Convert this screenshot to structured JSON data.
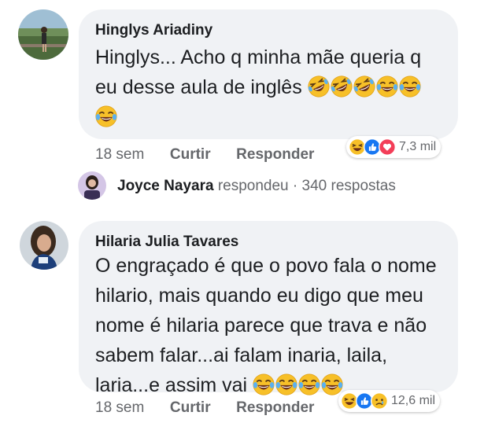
{
  "comments": [
    {
      "author": "Hinglys Ariadiny",
      "text": "Hinglys... Acho q minha mãe queria q eu desse aula de inglês",
      "text_line1": "Hinglys... Acho q minha mãe queria q",
      "text_line2": "eu desse aula de inglês",
      "emojis": [
        "rofl-emoji",
        "rofl-emoji",
        "rofl-emoji",
        "joy-emoji",
        "joy-emoji",
        "joy-emoji"
      ],
      "time": "18 sem",
      "like_label": "Curtir",
      "reply_label": "Responder",
      "reactions": [
        "haha-icon",
        "like-icon",
        "love-icon"
      ],
      "reaction_count": "7,3 mil"
    },
    {
      "author": "Hilaria Julia Tavares",
      "text_line1": "O engraçado é que o povo fala o nome",
      "text_line2": "hilario, mais quando eu digo que meu",
      "text_line3": "nome é hilaria parece que trava e não",
      "text_line4": "sabem falar...ai falam inaria, laila,",
      "text_line5": "laria...e assim vai",
      "emojis": [
        "joy-emoji",
        "joy-emoji",
        "joy-emoji",
        "joy-emoji"
      ],
      "time": "18 sem",
      "like_label": "Curtir",
      "reply_label": "Responder",
      "reactions": [
        "haha-icon",
        "like-icon",
        "sad-icon"
      ],
      "reaction_count": "12,6 mil"
    }
  ],
  "reply_summary": {
    "name": "Joyce Nayara",
    "action": "respondeu",
    "separator": "·",
    "count": "340 respostas"
  },
  "colors": {
    "bubble": "#f0f2f5",
    "meta_text": "#65676b",
    "like_blue": "#1877f2",
    "love_red": "#f33e58",
    "emoji_yellow": "#f7b125"
  }
}
